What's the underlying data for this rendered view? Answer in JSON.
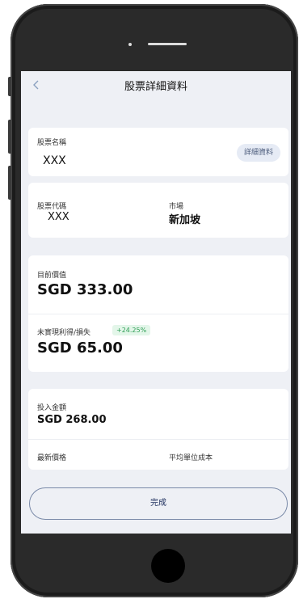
{
  "header": {
    "title": "股票詳細資料",
    "back_icon": "chevron-left-icon"
  },
  "stock_name": {
    "label": "股票名稱",
    "value": "XXX",
    "details_button": "詳細資料"
  },
  "stock_code": {
    "label": "股票代碼",
    "value": "XXX"
  },
  "market": {
    "label": "市場",
    "value": "新加坡"
  },
  "current_value": {
    "label": "目前價值",
    "value": "SGD 333.00"
  },
  "unrealized": {
    "label": "未實現利得/損失",
    "change": "+24.25%",
    "value": "SGD 65.00"
  },
  "investment": {
    "label": "投入金額",
    "value": "SGD 268.00"
  },
  "latest_price": {
    "label": "最新價格"
  },
  "avg_cost": {
    "label": "平均單位成本"
  },
  "footer": {
    "done_label": "完成"
  }
}
